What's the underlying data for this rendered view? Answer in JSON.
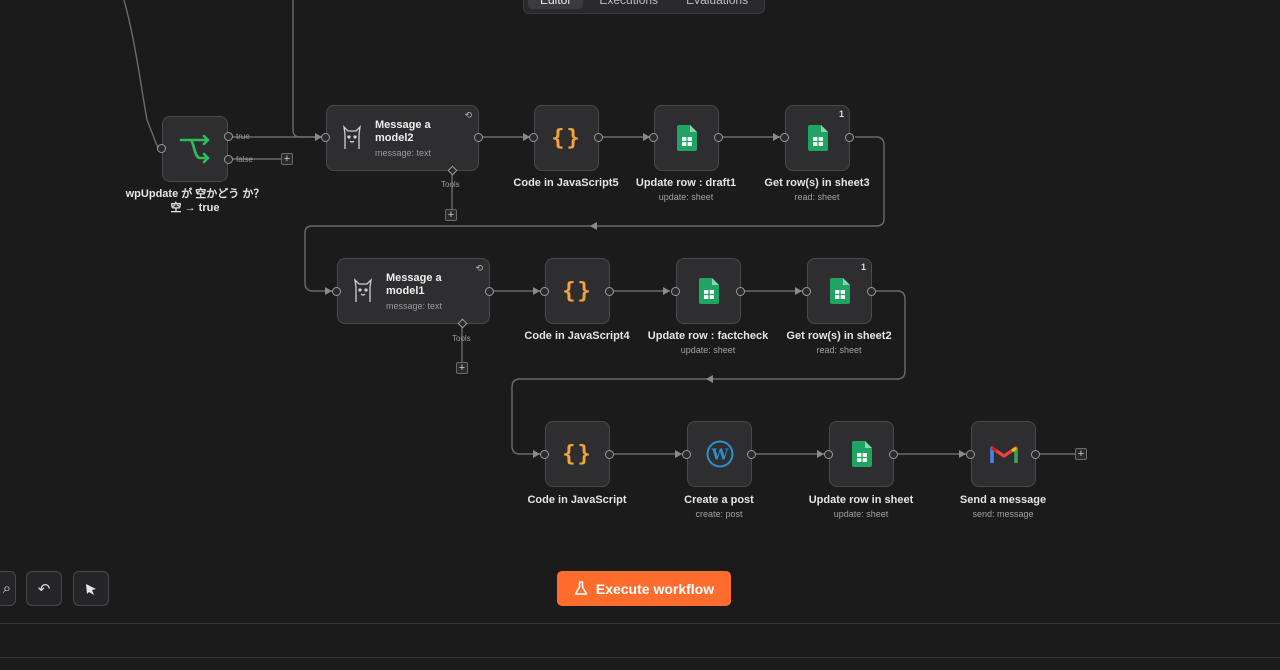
{
  "tabs": [
    "Editor",
    "Executions",
    "Evaluations"
  ],
  "nodes": {
    "if": {
      "label": "wpUpdate が 空かどう か？ 空 → true",
      "true_label": "true",
      "false_label": "false"
    },
    "model2": {
      "title": "Message a model2",
      "sub": "message: text",
      "tools": "Tools"
    },
    "code5": {
      "label": "Code in JavaScript5"
    },
    "update_draft1": {
      "label": "Update row : draft1",
      "sub": "update: sheet"
    },
    "get_sheet3": {
      "label": "Get row(s) in sheet3",
      "sub": "read: sheet",
      "badge": "1"
    },
    "model1": {
      "title": "Message a model1",
      "sub": "message: text",
      "tools": "Tools"
    },
    "code4": {
      "label": "Code in JavaScript4"
    },
    "update_factcheck": {
      "label": "Update row : factcheck",
      "sub": "update: sheet"
    },
    "get_sheet2": {
      "label": "Get row(s) in sheet2",
      "sub": "read: sheet",
      "badge": "1"
    },
    "code": {
      "label": "Code in JavaScript"
    },
    "create_post": {
      "label": "Create a post",
      "sub": "create: post"
    },
    "update_row_sheet": {
      "label": "Update row in sheet",
      "sub": "update: sheet"
    },
    "send_message": {
      "label": "Send a message",
      "sub": "send: message"
    }
  },
  "icons": {
    "code": "curly-braces-icon",
    "sheets": "google-sheets-icon",
    "llm": "llama-icon",
    "wp": "wordpress-icon",
    "gmail": "gmail-icon",
    "if": "branch-icon"
  },
  "colors": {
    "accent": "#ff6d2e",
    "sheets": "#1fa463",
    "code": "#f5a23a",
    "branch": "#2bbf5c"
  },
  "toolbar": {
    "execute_label": "Execute workflow"
  }
}
